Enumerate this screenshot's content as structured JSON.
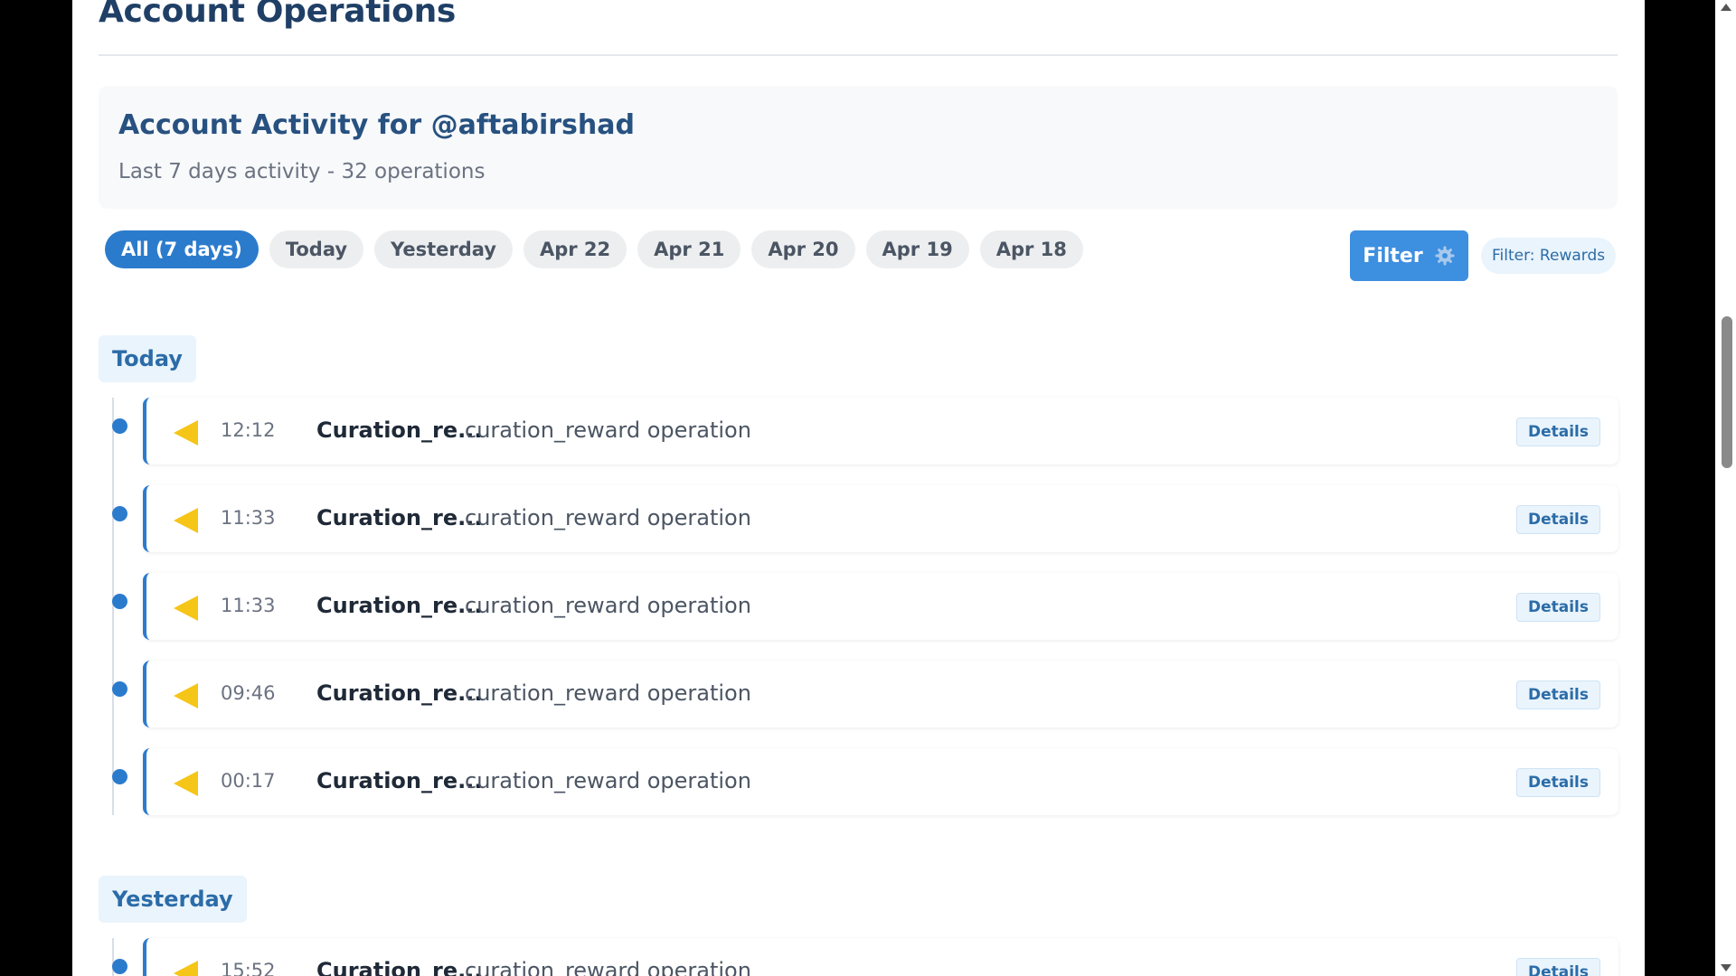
{
  "page": {
    "title": "Account Operations"
  },
  "activity": {
    "title": "Account Activity for @aftabirshad",
    "subtitle": "Last 7 days activity - 32 operations"
  },
  "date_tabs": [
    {
      "label": "All (7 days)",
      "active": true
    },
    {
      "label": "Today",
      "active": false
    },
    {
      "label": "Yesterday",
      "active": false
    },
    {
      "label": "Apr 22",
      "active": false
    },
    {
      "label": "Apr 21",
      "active": false
    },
    {
      "label": "Apr 20",
      "active": false
    },
    {
      "label": "Apr 19",
      "active": false
    },
    {
      "label": "Apr 18",
      "active": false
    }
  ],
  "filter": {
    "button_label": "Filter",
    "button_icon": "gear-icon",
    "active_chip": "Filter: Rewards"
  },
  "groups": [
    {
      "label": "Today",
      "operations": [
        {
          "time": "12:12",
          "type": "Curation_re...",
          "description": "curation_reward operation",
          "details_label": "Details",
          "icon": "reward-triangle-icon"
        },
        {
          "time": "11:33",
          "type": "Curation_re...",
          "description": "curation_reward operation",
          "details_label": "Details",
          "icon": "reward-triangle-icon"
        },
        {
          "time": "11:33",
          "type": "Curation_re...",
          "description": "curation_reward operation",
          "details_label": "Details",
          "icon": "reward-triangle-icon"
        },
        {
          "time": "09:46",
          "type": "Curation_re...",
          "description": "curation_reward operation",
          "details_label": "Details",
          "icon": "reward-triangle-icon"
        },
        {
          "time": "00:17",
          "type": "Curation_re...",
          "description": "curation_reward operation",
          "details_label": "Details",
          "icon": "reward-triangle-icon"
        }
      ]
    },
    {
      "label": "Yesterday",
      "operations": [
        {
          "time": "15:52",
          "type": "Curation_re...",
          "description": "curation_reward operation",
          "details_label": "Details",
          "icon": "reward-triangle-icon"
        }
      ]
    }
  ],
  "colors": {
    "accent": "#2b7bcd",
    "title": "#1f3f66",
    "reward_icon": "#f5c518",
    "chip_bg": "#eaf4fc"
  }
}
